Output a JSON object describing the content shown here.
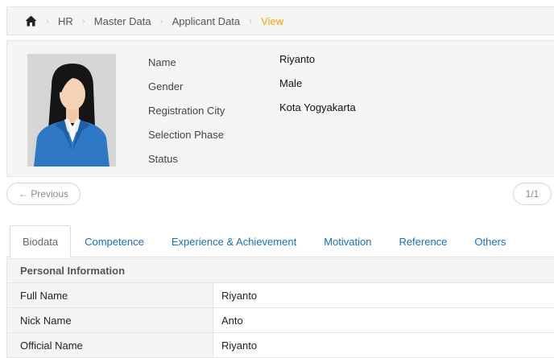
{
  "breadcrumb": {
    "home_icon": "home-icon",
    "items": [
      "HR",
      "Master Data",
      "Applicant Data"
    ],
    "active": "View"
  },
  "profile": {
    "photo_icon": "female-avatar-icon",
    "labels": [
      "Name",
      "Gender",
      "Registration City",
      "Selection Phase",
      "Status"
    ],
    "values": [
      "Riyanto",
      "Male",
      "Kota Yogyakarta",
      "",
      ""
    ]
  },
  "pager": {
    "previous_label": "← Previous",
    "count": "1/1"
  },
  "tabs": [
    {
      "label": "Biodata",
      "active": true
    },
    {
      "label": "Competence",
      "active": false
    },
    {
      "label": "Experience & Achievement",
      "active": false
    },
    {
      "label": "Motivation",
      "active": false
    },
    {
      "label": "Reference",
      "active": false
    },
    {
      "label": "Others",
      "active": false
    }
  ],
  "personal_info": {
    "title": "Personal Information",
    "rows": [
      {
        "key": "Full Name",
        "value": "Riyanto"
      },
      {
        "key": "Nick Name",
        "value": "Anto"
      },
      {
        "key": "Official Name",
        "value": "Riyanto"
      }
    ]
  },
  "colors": {
    "link": "#1a6fb5",
    "breadcrumb_active": "#f0a500",
    "panel_bg": "#f5f5f5"
  }
}
